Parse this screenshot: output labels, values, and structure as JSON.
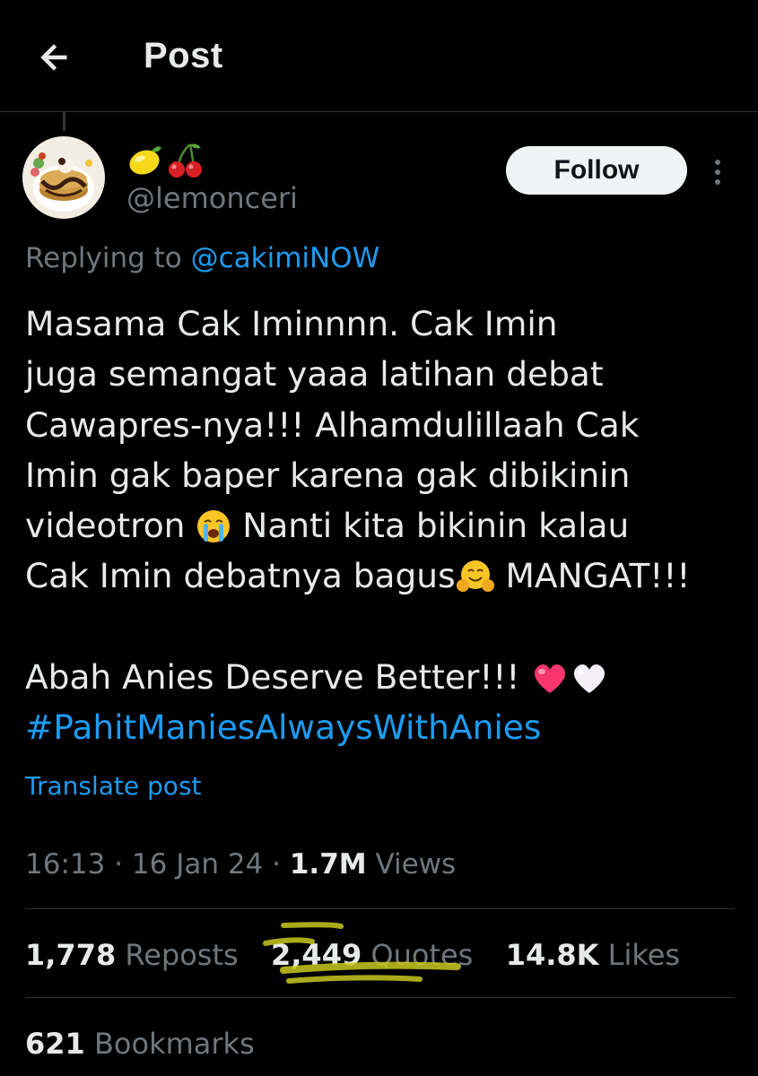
{
  "header": {
    "title": "Post",
    "back_icon": "arrow-left-icon"
  },
  "author": {
    "display_name_icons": [
      "lemon-emoji-icon",
      "cherries-emoji-icon"
    ],
    "handle": "@lemonceri",
    "follow_label": "Follow",
    "more_icon": "more-vertical-icon"
  },
  "reply": {
    "prefix": "Replying to ",
    "handle": "@cakimiNOW"
  },
  "post": {
    "line1": "Masama Cak Iminnnn. Cak Imin",
    "line2": "juga semangat yaaa latihan debat",
    "line3": "Cawapres-nya!!! Alhamdulillaah Cak",
    "line4": "Imin gak baper karena gak dibikinin",
    "line5_a": "videotron ",
    "line5_b": " Nanti kita bikinin kalau",
    "line6_a": "Cak Imin debatnya bagus",
    "line6_b": " MANGAT!!!",
    "line7": "Abah Anies Deserve Better!!! ",
    "hashtag": "#PahitManiesAlwaysWithAnies",
    "emoji_icons": [
      "crying-face-emoji-icon",
      "hugging-face-emoji-icon",
      "pink-heart-emoji-icon",
      "white-heart-emoji-icon"
    ]
  },
  "translate_label": "Translate post",
  "meta": {
    "time": "16:13",
    "sep": " · ",
    "date": "16 Jan 24",
    "views_count": "1.7M",
    "views_label": " Views"
  },
  "stats": {
    "reposts_count": "1,778",
    "reposts_label": " Reposts",
    "quotes_count": "2,449",
    "quotes_label": " Quotes",
    "likes_count": "14.8K",
    "likes_label": " Likes"
  },
  "bookmarks": {
    "count": "621",
    "label": " Bookmarks"
  },
  "colors": {
    "background": "#000000",
    "text": "#e7e9ea",
    "secondary": "#71767b",
    "accent": "#1d9bf0",
    "highlight": "#c8c81e",
    "divider": "#2f3336"
  }
}
